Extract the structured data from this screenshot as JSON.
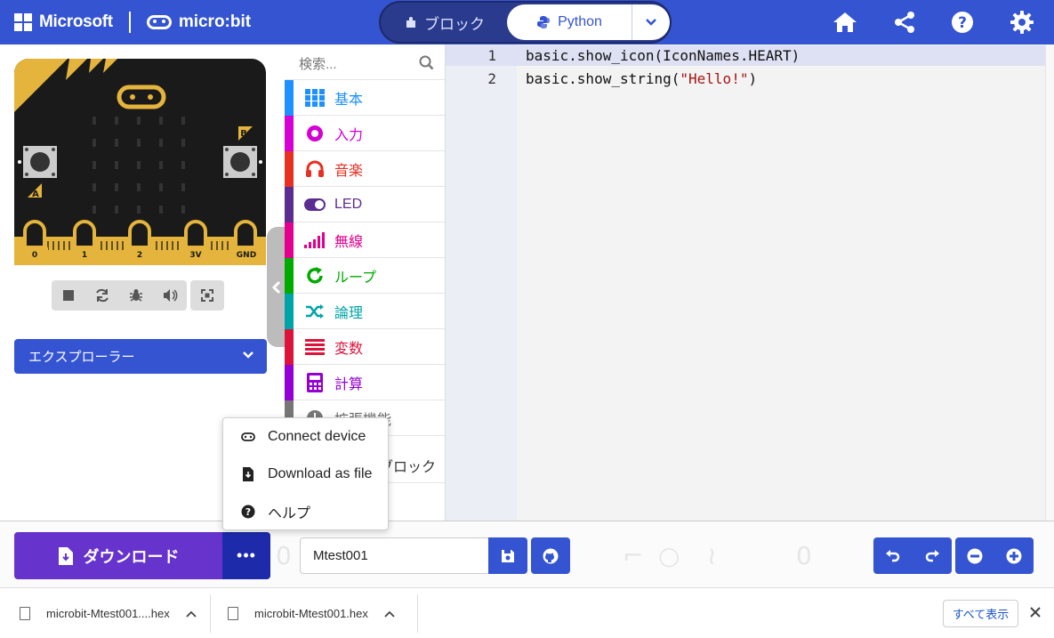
{
  "header": {
    "microsoft_label": "Microsoft",
    "microbit_label": "micro:bit",
    "tab_blocks": "ブロック",
    "tab_python": "Python"
  },
  "toolbox": {
    "search_placeholder": "検索...",
    "categories": [
      {
        "label": "基本",
        "color": "#1E90FF"
      },
      {
        "label": "入力",
        "color": "#D400D4"
      },
      {
        "label": "音楽",
        "color": "#E63022"
      },
      {
        "label": "LED",
        "color": "#5C2D91"
      },
      {
        "label": "無線",
        "color": "#E3008C"
      },
      {
        "label": "ループ",
        "color": "#00AA00"
      },
      {
        "label": "論理",
        "color": "#00A4A6"
      },
      {
        "label": "変数",
        "color": "#DC143C"
      },
      {
        "label": "計算",
        "color": "#9400D3"
      },
      {
        "label": "拡張機能",
        "color": "#777777"
      }
    ],
    "advanced_fragment": "ブロック"
  },
  "simulator": {
    "explorer_label": "エクスプローラー",
    "pins": [
      "0",
      "1",
      "2",
      "3V",
      "GND"
    ],
    "button_a": "A",
    "button_b": "B"
  },
  "editor": {
    "lines": [
      {
        "num": "1",
        "before": "basic.show_icon(IconNames.HEART)",
        "str": "",
        "after": ""
      },
      {
        "num": "2",
        "before": "basic.show_string(",
        "str": "\"Hello!\"",
        "after": ")"
      }
    ]
  },
  "menu": {
    "items": [
      {
        "label": "Connect device",
        "icon": "link-icon"
      },
      {
        "label": "Download as file",
        "icon": "file-download-icon"
      },
      {
        "label": "ヘルプ",
        "icon": "question-circle-icon"
      }
    ]
  },
  "bottom": {
    "download_label": "ダウンロード",
    "more_label": "•••",
    "project_name": "Mtest001"
  },
  "shelf": {
    "file1": "microbit-Mtest001....hex",
    "file2": "microbit-Mtest001.hex",
    "show_all": "すべて表示"
  },
  "colors": {
    "brand_blue": "#3454D1",
    "download_purple": "#6633CC",
    "download_more": "#1D2BAB",
    "board_black": "#1a1a1a",
    "board_gold": "#E4B43C"
  }
}
